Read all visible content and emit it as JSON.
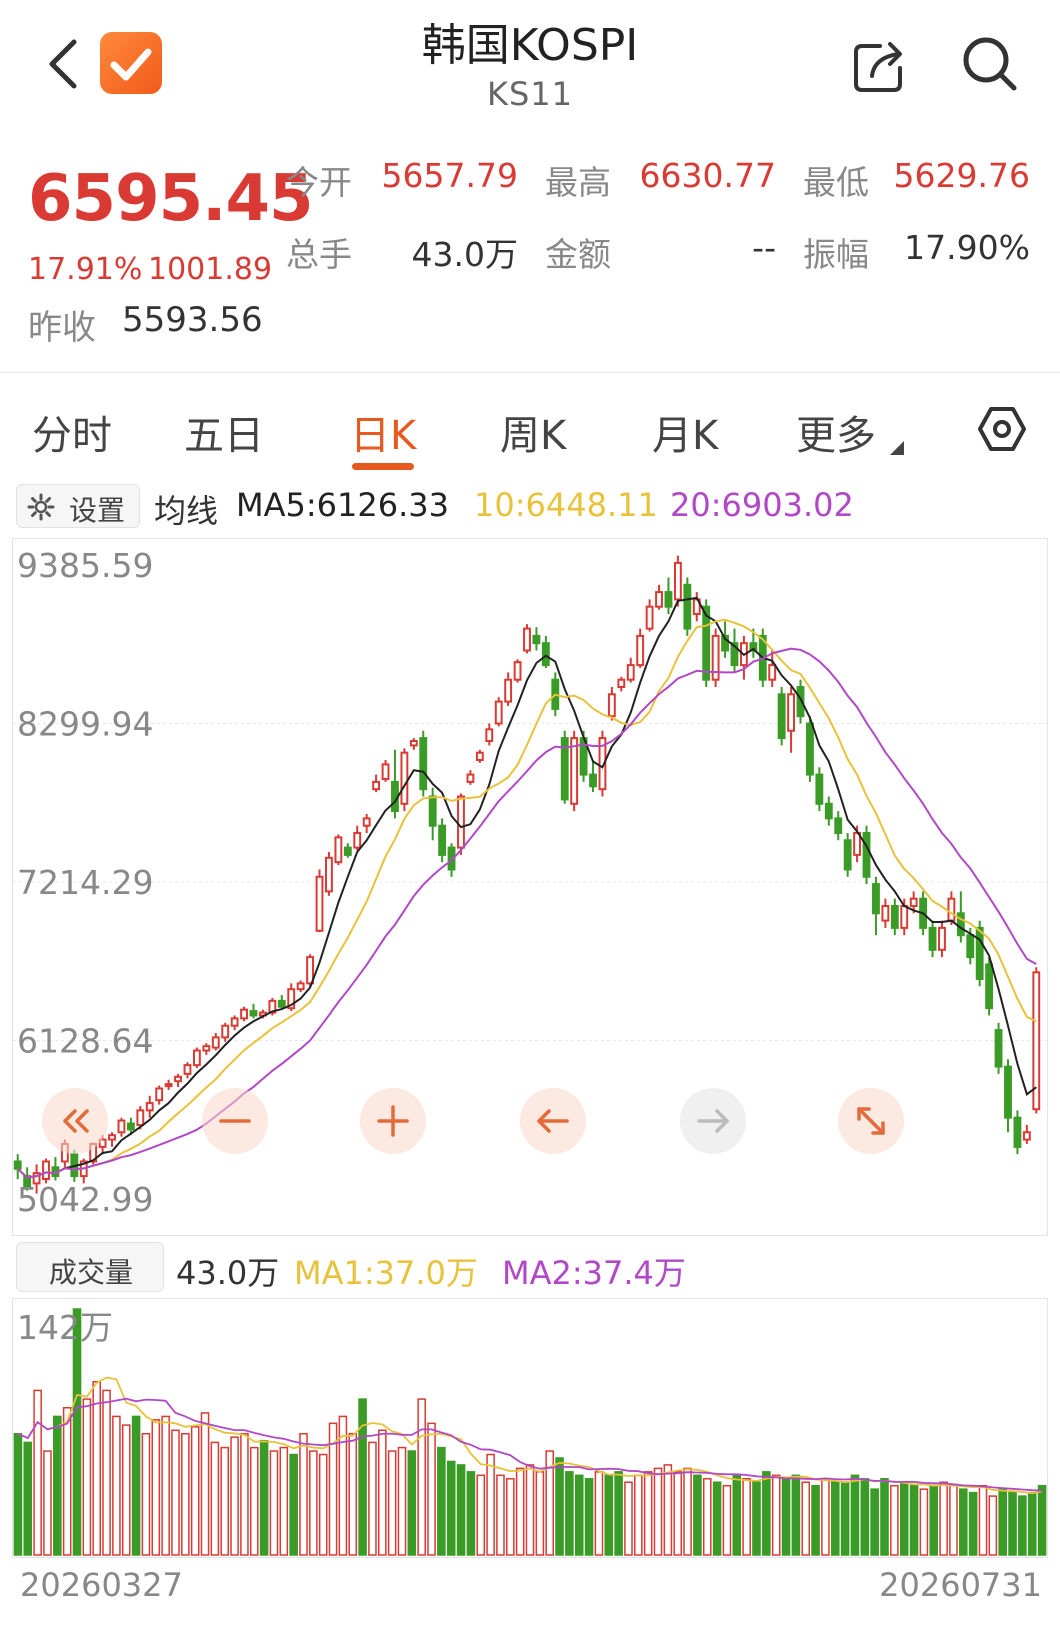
{
  "header": {
    "title": "韩国KOSPI",
    "subtitle": "KS11"
  },
  "quote": {
    "price": "6595.45",
    "change_pct": "17.91%",
    "change_abs": "1001.89",
    "prev_close_label": "昨收",
    "prev_close_value": "5593.56",
    "stats": [
      {
        "label": "今开",
        "value": "5657.79"
      },
      {
        "label": "最高",
        "value": "6630.77"
      },
      {
        "label": "最低",
        "value": "5629.76"
      },
      {
        "label": "总手",
        "value": "43.0万"
      },
      {
        "label": "金额",
        "value": "--"
      },
      {
        "label": "振幅",
        "value": "17.90%"
      }
    ]
  },
  "tabs": [
    {
      "label": "分时"
    },
    {
      "label": "五日"
    },
    {
      "label": "日K",
      "active": true
    },
    {
      "label": "周K"
    },
    {
      "label": "月K"
    },
    {
      "label": "更多"
    }
  ],
  "ma": {
    "settings_label": "设置",
    "prefix": "均线",
    "ma5": "MA5:6126.33",
    "ma10": "10:6448.11",
    "ma20": "20:6903.02"
  },
  "volume": {
    "label": "成交量",
    "current": "43.0万",
    "ma1": "MA1:37.0万",
    "ma2": "MA2:37.4万"
  },
  "colors": {
    "up": "#d93a33",
    "down": "#3a9b27",
    "ma5": "#222222",
    "ma10": "#e8c23a",
    "ma20": "#b148c8",
    "accent": "#e65a1f"
  },
  "icons": [
    "back-icon",
    "app-logo-icon",
    "share-icon",
    "search-icon",
    "hexagon-settings-icon",
    "gear-icon"
  ],
  "controls": [
    "rewind-icon",
    "zoom-out-icon",
    "zoom-in-icon",
    "arrow-left-icon",
    "arrow-right-icon",
    "expand-icon"
  ],
  "chart_data": {
    "type": "candlestick",
    "x_range": [
      "20260327",
      "20260731"
    ],
    "y_ticks": [
      "9385.59",
      "8299.94",
      "7214.29",
      "6128.64",
      "5042.99"
    ],
    "ylim": [
      5042.99,
      9385.59
    ],
    "volume_max_label": "142万",
    "candles": [
      [
        5300,
        5250,
        5350,
        5180
      ],
      [
        5200,
        5130,
        5260,
        5100
      ],
      [
        5150,
        5220,
        5280,
        5080
      ],
      [
        5180,
        5300,
        5320,
        5150
      ],
      [
        5260,
        5200,
        5330,
        5170
      ],
      [
        5300,
        5420,
        5450,
        5250
      ],
      [
        5350,
        5200,
        5380,
        5160
      ],
      [
        5200,
        5300,
        5320,
        5150
      ],
      [
        5300,
        5420,
        5430,
        5280
      ],
      [
        5400,
        5450,
        5480,
        5350
      ],
      [
        5450,
        5480,
        5500,
        5400
      ],
      [
        5500,
        5580,
        5600,
        5470
      ],
      [
        5560,
        5520,
        5600,
        5480
      ],
      [
        5550,
        5650,
        5680,
        5520
      ],
      [
        5650,
        5700,
        5750,
        5600
      ],
      [
        5720,
        5800,
        5820,
        5690
      ],
      [
        5820,
        5830,
        5860,
        5790
      ],
      [
        5850,
        5880,
        5900,
        5810
      ],
      [
        5900,
        5960,
        5980,
        5870
      ],
      [
        5960,
        6060,
        6080,
        5940
      ],
      [
        6060,
        6090,
        6110,
        6030
      ],
      [
        6080,
        6150,
        6180,
        6060
      ],
      [
        6150,
        6230,
        6250,
        6120
      ],
      [
        6230,
        6280,
        6300,
        6200
      ],
      [
        6280,
        6340,
        6360,
        6260
      ],
      [
        6330,
        6300,
        6380,
        6280
      ],
      [
        6300,
        6320,
        6340,
        6280
      ],
      [
        6320,
        6400,
        6420,
        6300
      ],
      [
        6400,
        6360,
        6440,
        6340
      ],
      [
        6350,
        6480,
        6520,
        6330
      ],
      [
        6480,
        6520,
        6540,
        6460
      ],
      [
        6520,
        6700,
        6720,
        6500
      ],
      [
        6880,
        7250,
        7300,
        6870
      ],
      [
        7150,
        7380,
        7420,
        7120
      ],
      [
        7350,
        7520,
        7540,
        7330
      ],
      [
        7450,
        7400,
        7480,
        7380
      ],
      [
        7450,
        7550,
        7600,
        7430
      ],
      [
        7600,
        7650,
        7680,
        7550
      ],
      [
        7850,
        7900,
        7950,
        7830
      ],
      [
        7920,
        8020,
        8050,
        7900
      ],
      [
        7900,
        7700,
        8120,
        7650
      ],
      [
        7750,
        8100,
        8130,
        7700
      ],
      [
        8150,
        8180,
        8200,
        8120
      ],
      [
        8200,
        7850,
        8250,
        7800
      ],
      [
        7800,
        7600,
        7860,
        7500
      ],
      [
        7600,
        7400,
        7650,
        7350
      ],
      [
        7450,
        7300,
        7480,
        7250
      ],
      [
        7450,
        7800,
        7820,
        7400
      ],
      [
        7900,
        7950,
        7980,
        7880
      ],
      [
        8050,
        8100,
        8120,
        8030
      ],
      [
        8180,
        8260,
        8300,
        8150
      ],
      [
        8300,
        8450,
        8480,
        8280
      ],
      [
        8450,
        8600,
        8650,
        8420
      ],
      [
        8600,
        8720,
        8740,
        8580
      ],
      [
        8800,
        8950,
        8980,
        8780
      ],
      [
        8900,
        8850,
        8960,
        8800
      ],
      [
        8850,
        8700,
        8900,
        8680
      ],
      [
        8600,
        8400,
        8650,
        8350
      ],
      [
        8200,
        7780,
        8250,
        7750
      ],
      [
        7750,
        8200,
        8250,
        7700
      ],
      [
        8200,
        7950,
        8250,
        7900
      ],
      [
        7950,
        7870,
        8050,
        7830
      ],
      [
        7850,
        8200,
        8250,
        7800
      ],
      [
        8350,
        8500,
        8550,
        8320
      ],
      [
        8550,
        8600,
        8620,
        8520
      ],
      [
        8600,
        8700,
        8750,
        8580
      ],
      [
        8700,
        8900,
        8950,
        8680
      ],
      [
        8950,
        9100,
        9150,
        8930
      ],
      [
        9100,
        9200,
        9250,
        9080
      ],
      [
        9200,
        9100,
        9300,
        9050
      ],
      [
        9150,
        9400,
        9450,
        9100
      ],
      [
        9250,
        8950,
        9300,
        8900
      ],
      [
        9050,
        9150,
        9200,
        9000
      ],
      [
        9100,
        8600,
        9150,
        8550
      ],
      [
        8600,
        8900,
        8950,
        8550
      ],
      [
        8900,
        8800,
        9000,
        8750
      ],
      [
        8850,
        8700,
        8950,
        8650
      ],
      [
        8700,
        8850,
        8900,
        8600
      ],
      [
        8850,
        8800,
        8950,
        8750
      ],
      [
        8900,
        8600,
        8950,
        8550
      ],
      [
        8600,
        8700,
        8800,
        8550
      ],
      [
        8500,
        8200,
        8550,
        8150
      ],
      [
        8250,
        8500,
        8550,
        8100
      ],
      [
        8550,
        8350,
        8600,
        8300
      ],
      [
        8300,
        7950,
        8350,
        7900
      ],
      [
        7950,
        7750,
        8000,
        7700
      ],
      [
        7750,
        7650,
        7800,
        7600
      ],
      [
        7650,
        7550,
        7700,
        7500
      ],
      [
        7500,
        7300,
        7550,
        7250
      ],
      [
        7400,
        7550,
        7600,
        7350
      ],
      [
        7550,
        7250,
        7600,
        7200
      ],
      [
        7200,
        7000,
        7250,
        6850
      ],
      [
        6950,
        7050,
        7100,
        6900
      ],
      [
        7050,
        6900,
        7100,
        6850
      ],
      [
        6900,
        7050,
        7100,
        6850
      ],
      [
        7050,
        7100,
        7150,
        7000
      ],
      [
        7100,
        6900,
        7150,
        6850
      ],
      [
        6900,
        6750,
        6950,
        6700
      ],
      [
        6750,
        6900,
        6950,
        6700
      ],
      [
        6950,
        7100,
        7150,
        6920
      ],
      [
        7000,
        6850,
        7150,
        6800
      ],
      [
        6850,
        6700,
        6900,
        6650
      ],
      [
        6900,
        6550,
        6950,
        6500
      ],
      [
        6650,
        6350,
        6700,
        6300
      ],
      [
        6200,
        5950,
        6250,
        5900
      ],
      [
        5950,
        5600,
        6000,
        5500
      ],
      [
        5600,
        5400,
        5650,
        5350
      ],
      [
        5450,
        5500,
        5550,
        5420
      ],
      [
        5657.79,
        6595.45,
        6630.77,
        5629.76
      ]
    ],
    "volume": [
      70,
      65,
      95,
      60,
      80,
      85,
      142,
      90,
      100,
      95,
      80,
      75,
      80,
      70,
      78,
      80,
      72,
      70,
      74,
      82,
      65,
      62,
      68,
      70,
      62,
      66,
      60,
      62,
      58,
      70,
      60,
      58,
      76,
      80,
      70,
      90,
      65,
      72,
      60,
      62,
      60,
      90,
      76,
      62,
      54,
      52,
      48,
      46,
      58,
      46,
      44,
      50,
      52,
      48,
      60,
      56,
      48,
      46,
      44,
      48,
      46,
      48,
      42,
      46,
      48,
      50,
      52,
      48,
      50,
      46,
      44,
      42,
      40,
      46,
      44,
      42,
      48,
      46,
      44,
      46,
      42,
      40,
      44,
      42,
      42,
      46,
      44,
      38,
      44,
      40,
      42,
      40,
      38,
      40,
      42,
      40,
      38,
      36,
      40,
      34,
      38,
      36,
      34,
      36,
      40
    ]
  }
}
